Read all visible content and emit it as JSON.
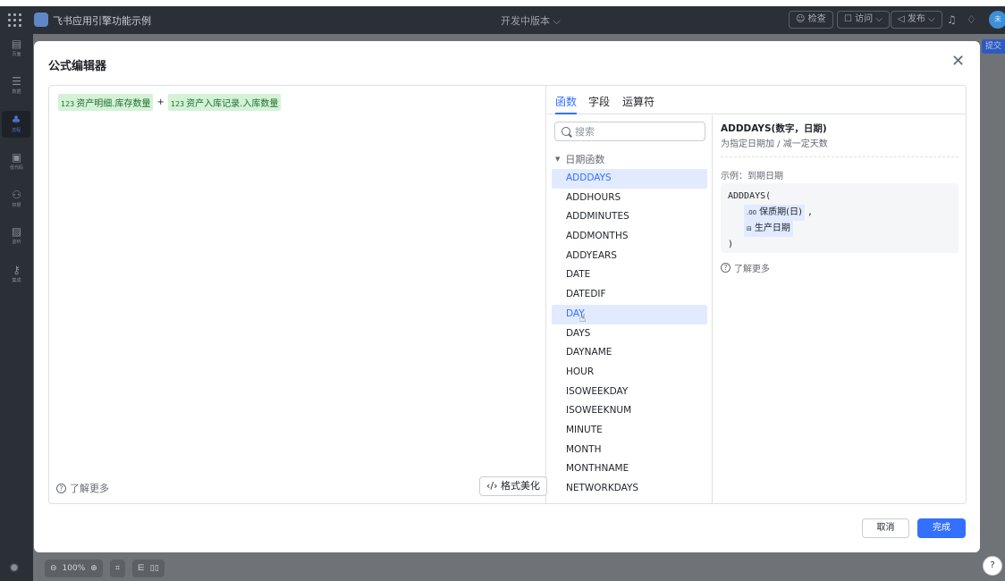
{
  "app": {
    "title": "飞书应用引擎功能示例",
    "version": "开发中版本 ⌵",
    "check_label": "☺ 检查",
    "visit_label": "☐ 访问 ⌵",
    "publish_label": "◁ 发布 ⌵",
    "avatar_text": "未",
    "submit_label": "提交"
  },
  "sidebar": {
    "items": [
      {
        "icon": "▤",
        "label": "页面"
      },
      {
        "icon": "☰",
        "label": "数据"
      },
      {
        "icon": "♣",
        "label": "流程"
      },
      {
        "icon": "▣",
        "label": "低代码"
      },
      {
        "icon": "⚇",
        "label": "权限"
      },
      {
        "icon": "▨",
        "label": "监听"
      },
      {
        "icon": "⚷",
        "label": "集成"
      }
    ]
  },
  "bottom_toolbar": {
    "zoom_out": "⊖",
    "zoom_level": "100%",
    "zoom_in": "⊕",
    "fit": "⌗",
    "layout_a": "⋿",
    "layout_b": "▯▯"
  },
  "modal": {
    "title": "公式编辑器",
    "formula": {
      "token1_prefix": "123",
      "token1_text": "资产明细.库存数量",
      "operator": "+",
      "token2_prefix": "123",
      "token2_text": "资产入库记录.入库数量"
    },
    "learn_more": "了解更多",
    "beautify_label": "格式美化",
    "beautify_icon": "‹/›",
    "tabs": [
      {
        "label": "函数"
      },
      {
        "label": "字段"
      },
      {
        "label": "运算符"
      }
    ],
    "search_placeholder": "搜索",
    "group_label": "日期函数",
    "functions": [
      "ADDDAYS",
      "ADDHOURS",
      "ADDMINUTES",
      "ADDMONTHS",
      "ADDYEARS",
      "DATE",
      "DATEDIF",
      "DAY",
      "DAYS",
      "DAYNAME",
      "HOUR",
      "ISOWEEKDAY",
      "ISOWEEKNUM",
      "MINUTE",
      "MONTH",
      "MONTHNAME",
      "NETWORKDAYS"
    ],
    "detail": {
      "signature": "ADDDAYS(数字，日期)",
      "description": "为指定日期加 / 减一定天数",
      "example_label": "示例：到期日期",
      "code_open": "ADDDAYS(",
      "arg1_prefix": ".00",
      "arg1": "保质期(日)",
      "comma": ",",
      "arg2_prefix": "⊟",
      "arg2": "生产日期",
      "code_close": ")",
      "learn_more": "了解更多"
    },
    "cancel_label": "取消",
    "done_label": "完成"
  },
  "colors": {
    "accent": "#3370ff",
    "token_bg": "#d4f2d6",
    "selected_bg": "#e1eaff"
  }
}
